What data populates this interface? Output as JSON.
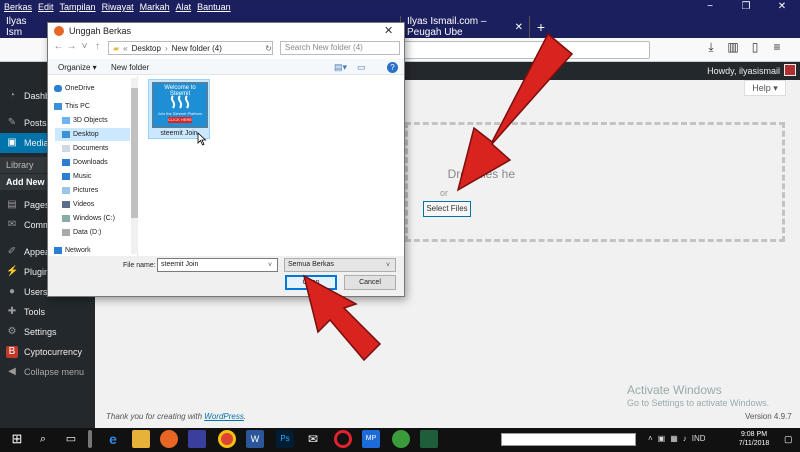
{
  "browser": {
    "menu": [
      "Berkas",
      "Edit",
      "Tampilan",
      "Riwayat",
      "Markah",
      "Alat",
      "Bantuan"
    ],
    "tabs": [
      {
        "label": "Ilyas Ism"
      },
      {
        "label": "Ilyas Ismail.com – Peugah Ube"
      }
    ],
    "window_controls": [
      "−",
      "❐",
      "✕"
    ]
  },
  "wp": {
    "howdy": "Howdy, ilyasismail",
    "sidebar": [
      {
        "label": "Dashb",
        "icon": "dashboard-icon"
      },
      {
        "label": "Posts",
        "icon": "pin-icon"
      },
      {
        "label": "Media",
        "icon": "media-icon"
      },
      {
        "label": "Pages",
        "icon": "page-icon"
      },
      {
        "label": "Comm",
        "icon": "comment-icon"
      },
      {
        "label": "Appear",
        "icon": "brush-icon"
      },
      {
        "label": "Plugin",
        "icon": "plug-icon"
      },
      {
        "label": "Users",
        "icon": "user-icon"
      },
      {
        "label": "Tools",
        "icon": "wrench-icon"
      },
      {
        "label": "Settings",
        "icon": "settings-icon"
      },
      {
        "label": "Cyptocurrency",
        "icon": "bitcoin-icon"
      },
      {
        "label": "Collapse menu",
        "icon": "collapse-icon"
      }
    ],
    "media_sub": [
      "Library",
      "Add New"
    ],
    "help": "Help ▾",
    "drop_text": "Drop files he",
    "or_text": "or",
    "select_files": "Select Files",
    "thanks_prefix": "Thank you for creating with ",
    "thanks_link": "WordPress",
    "thanks_suffix": ".",
    "version": "Version 4.9.7",
    "activate_title": "Activate Windows",
    "activate_sub": "Go to Settings to activate Windows."
  },
  "dialog": {
    "title": "Unggah Berkas",
    "path": [
      "«",
      "Desktop",
      "New folder (4)"
    ],
    "search_placeholder": "Search New folder (4)",
    "organize": "Organize ▾",
    "new_folder": "New folder",
    "nav_items": [
      {
        "label": "OneDrive"
      },
      {
        "label": "This PC"
      },
      {
        "label": "3D Objects"
      },
      {
        "label": "Desktop"
      },
      {
        "label": "Documents"
      },
      {
        "label": "Downloads"
      },
      {
        "label": "Music"
      },
      {
        "label": "Pictures"
      },
      {
        "label": "Videos"
      },
      {
        "label": "Windows (C:)"
      },
      {
        "label": "Data (D:)"
      },
      {
        "label": "Network"
      }
    ],
    "file": {
      "name": "steemit Join",
      "thumb_title": "Welcome to Steemit",
      "thumb_sub": "Join the Steemit Platform",
      "thumb_btn": "CLICK HERE"
    },
    "file_name_label": "File name:",
    "file_name_value": "steemit Join",
    "file_type": "Semua Berkas",
    "open": "Open",
    "cancel": "Cancel"
  },
  "taskbar": {
    "tray_lang": "IND",
    "time": "9:08 PM",
    "date": "7/11/2018"
  },
  "colors": {
    "wp_dark": "#23282d",
    "wp_blue": "#0073aa",
    "browser_dark": "#1b1f5e",
    "arrow": "#d8231f"
  }
}
